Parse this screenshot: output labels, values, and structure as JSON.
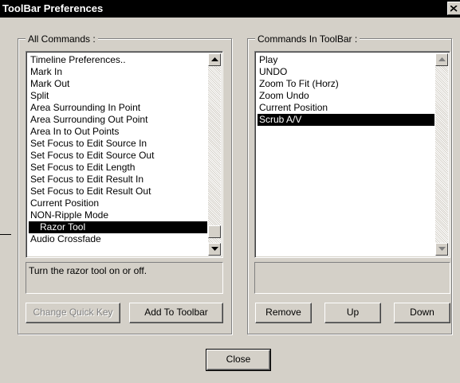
{
  "window": {
    "title": "ToolBar Preferences"
  },
  "all_commands": {
    "legend": "All Commands :",
    "items": [
      "Timeline Preferences..",
      "Mark In",
      "Mark Out",
      "Split",
      "Area Surrounding In Point",
      "Area Surrounding Out Point",
      "Area In to Out Points",
      "Set Focus to Edit Source In",
      "Set Focus to Edit Source Out",
      "Set Focus to Edit Length",
      "Set Focus to Edit Result In",
      "Set Focus to Edit Result Out",
      "Current Position",
      "NON-Ripple Mode",
      "Razor Tool",
      "Audio Crossfade"
    ],
    "selected": "Razor Tool",
    "description": "Turn the razor tool on or off.",
    "buttons": {
      "change_quick_key": "Change Quick Key",
      "add_to_toolbar": "Add To Toolbar"
    }
  },
  "toolbar_commands": {
    "legend": "Commands In ToolBar :",
    "items": [
      "Play",
      "UNDO",
      "Zoom To Fit (Horz)",
      "Zoom Undo",
      "Current Position",
      "Scrub A/V"
    ],
    "selected": "Scrub A/V",
    "description": "",
    "buttons": {
      "remove": "Remove",
      "up": "Up",
      "down": "Down"
    }
  },
  "footer": {
    "close": "Close"
  },
  "icons": {
    "close": "close-x-icon",
    "scroll_up": "arrow-up-icon",
    "scroll_down": "arrow-down-icon"
  },
  "colors": {
    "face": "#d4d0c8",
    "title_bar": "#000000",
    "selection": "#000000"
  }
}
